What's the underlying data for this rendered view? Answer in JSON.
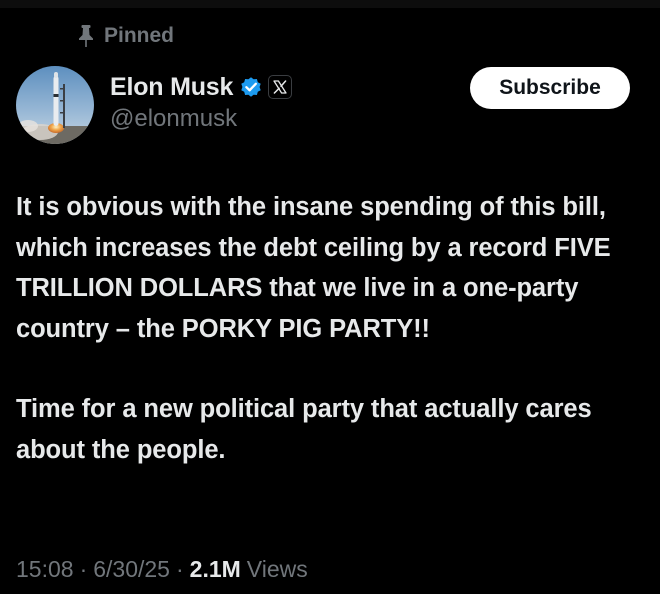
{
  "pinned": {
    "label": "Pinned",
    "icon": "pin-icon"
  },
  "author": {
    "display_name": "Elon Musk",
    "handle": "@elonmusk",
    "verified_icon": "verified-badge-icon",
    "verified_color": "#1d9bf0",
    "affiliation_icon": "x-logo-icon"
  },
  "subscribe": {
    "label": "Subscribe"
  },
  "tweet": {
    "paragraphs": [
      "It is obvious with the insane spending of this bill, which increases the debt ceiling by a record FIVE TRILLION DOLLARS that we live in a one-party country – the PORKY PIG PARTY!!",
      "Time for a new political party that actually cares about the people."
    ]
  },
  "meta": {
    "time": "15:08",
    "date": "6/30/25",
    "separator": "·",
    "views_count": "2.1M",
    "views_label": "Views"
  },
  "colors": {
    "background": "#000000",
    "text_primary": "#e7e9ea",
    "text_secondary": "#71767b",
    "button_bg": "#ffffff",
    "button_text": "#0f1419"
  }
}
